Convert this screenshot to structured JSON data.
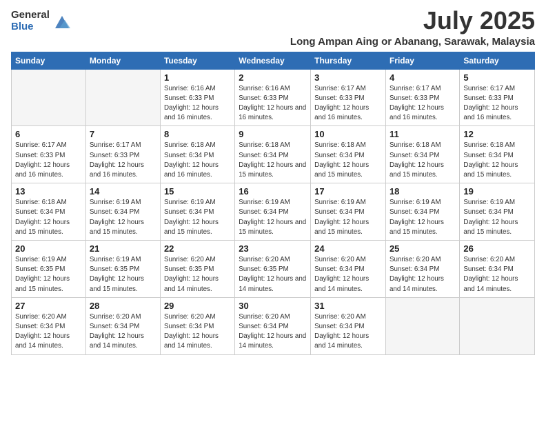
{
  "logo": {
    "general": "General",
    "blue": "Blue"
  },
  "title": "July 2025",
  "subtitle": "Long Ampan Aing or Abanang, Sarawak, Malaysia",
  "weekdays": [
    "Sunday",
    "Monday",
    "Tuesday",
    "Wednesday",
    "Thursday",
    "Friday",
    "Saturday"
  ],
  "weeks": [
    [
      {
        "day": "",
        "info": ""
      },
      {
        "day": "",
        "info": ""
      },
      {
        "day": "1",
        "info": "Sunrise: 6:16 AM\nSunset: 6:33 PM\nDaylight: 12 hours and 16 minutes."
      },
      {
        "day": "2",
        "info": "Sunrise: 6:16 AM\nSunset: 6:33 PM\nDaylight: 12 hours and 16 minutes."
      },
      {
        "day": "3",
        "info": "Sunrise: 6:17 AM\nSunset: 6:33 PM\nDaylight: 12 hours and 16 minutes."
      },
      {
        "day": "4",
        "info": "Sunrise: 6:17 AM\nSunset: 6:33 PM\nDaylight: 12 hours and 16 minutes."
      },
      {
        "day": "5",
        "info": "Sunrise: 6:17 AM\nSunset: 6:33 PM\nDaylight: 12 hours and 16 minutes."
      }
    ],
    [
      {
        "day": "6",
        "info": "Sunrise: 6:17 AM\nSunset: 6:33 PM\nDaylight: 12 hours and 16 minutes."
      },
      {
        "day": "7",
        "info": "Sunrise: 6:17 AM\nSunset: 6:33 PM\nDaylight: 12 hours and 16 minutes."
      },
      {
        "day": "8",
        "info": "Sunrise: 6:18 AM\nSunset: 6:34 PM\nDaylight: 12 hours and 16 minutes."
      },
      {
        "day": "9",
        "info": "Sunrise: 6:18 AM\nSunset: 6:34 PM\nDaylight: 12 hours and 15 minutes."
      },
      {
        "day": "10",
        "info": "Sunrise: 6:18 AM\nSunset: 6:34 PM\nDaylight: 12 hours and 15 minutes."
      },
      {
        "day": "11",
        "info": "Sunrise: 6:18 AM\nSunset: 6:34 PM\nDaylight: 12 hours and 15 minutes."
      },
      {
        "day": "12",
        "info": "Sunrise: 6:18 AM\nSunset: 6:34 PM\nDaylight: 12 hours and 15 minutes."
      }
    ],
    [
      {
        "day": "13",
        "info": "Sunrise: 6:18 AM\nSunset: 6:34 PM\nDaylight: 12 hours and 15 minutes."
      },
      {
        "day": "14",
        "info": "Sunrise: 6:19 AM\nSunset: 6:34 PM\nDaylight: 12 hours and 15 minutes."
      },
      {
        "day": "15",
        "info": "Sunrise: 6:19 AM\nSunset: 6:34 PM\nDaylight: 12 hours and 15 minutes."
      },
      {
        "day": "16",
        "info": "Sunrise: 6:19 AM\nSunset: 6:34 PM\nDaylight: 12 hours and 15 minutes."
      },
      {
        "day": "17",
        "info": "Sunrise: 6:19 AM\nSunset: 6:34 PM\nDaylight: 12 hours and 15 minutes."
      },
      {
        "day": "18",
        "info": "Sunrise: 6:19 AM\nSunset: 6:34 PM\nDaylight: 12 hours and 15 minutes."
      },
      {
        "day": "19",
        "info": "Sunrise: 6:19 AM\nSunset: 6:34 PM\nDaylight: 12 hours and 15 minutes."
      }
    ],
    [
      {
        "day": "20",
        "info": "Sunrise: 6:19 AM\nSunset: 6:35 PM\nDaylight: 12 hours and 15 minutes."
      },
      {
        "day": "21",
        "info": "Sunrise: 6:19 AM\nSunset: 6:35 PM\nDaylight: 12 hours and 15 minutes."
      },
      {
        "day": "22",
        "info": "Sunrise: 6:20 AM\nSunset: 6:35 PM\nDaylight: 12 hours and 14 minutes."
      },
      {
        "day": "23",
        "info": "Sunrise: 6:20 AM\nSunset: 6:35 PM\nDaylight: 12 hours and 14 minutes."
      },
      {
        "day": "24",
        "info": "Sunrise: 6:20 AM\nSunset: 6:34 PM\nDaylight: 12 hours and 14 minutes."
      },
      {
        "day": "25",
        "info": "Sunrise: 6:20 AM\nSunset: 6:34 PM\nDaylight: 12 hours and 14 minutes."
      },
      {
        "day": "26",
        "info": "Sunrise: 6:20 AM\nSunset: 6:34 PM\nDaylight: 12 hours and 14 minutes."
      }
    ],
    [
      {
        "day": "27",
        "info": "Sunrise: 6:20 AM\nSunset: 6:34 PM\nDaylight: 12 hours and 14 minutes."
      },
      {
        "day": "28",
        "info": "Sunrise: 6:20 AM\nSunset: 6:34 PM\nDaylight: 12 hours and 14 minutes."
      },
      {
        "day": "29",
        "info": "Sunrise: 6:20 AM\nSunset: 6:34 PM\nDaylight: 12 hours and 14 minutes."
      },
      {
        "day": "30",
        "info": "Sunrise: 6:20 AM\nSunset: 6:34 PM\nDaylight: 12 hours and 14 minutes."
      },
      {
        "day": "31",
        "info": "Sunrise: 6:20 AM\nSunset: 6:34 PM\nDaylight: 12 hours and 14 minutes."
      },
      {
        "day": "",
        "info": ""
      },
      {
        "day": "",
        "info": ""
      }
    ]
  ]
}
